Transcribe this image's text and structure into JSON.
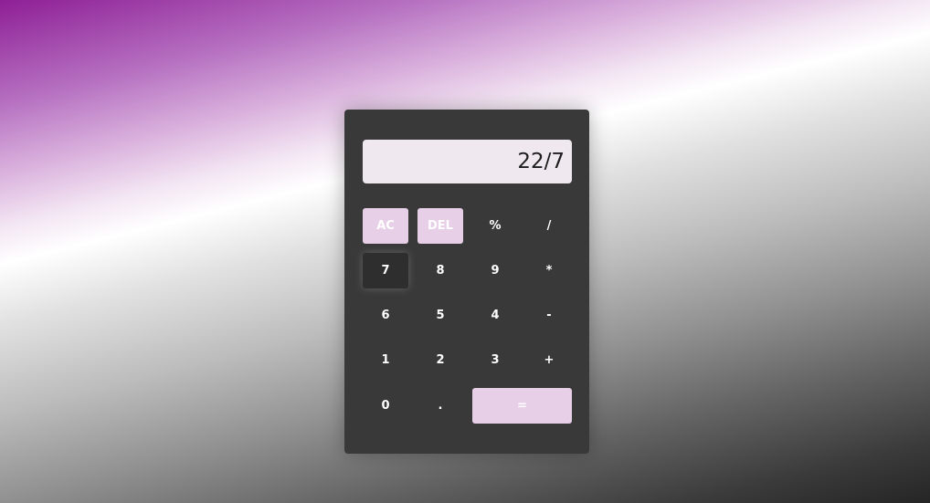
{
  "display": {
    "value": "22/7"
  },
  "keys": {
    "ac": "AC",
    "del": "DEL",
    "percent": "%",
    "divide": "/",
    "seven": "7",
    "eight": "8",
    "nine": "9",
    "multiply": "*",
    "six": "6",
    "five": "5",
    "four": "4",
    "minus": "-",
    "one": "1",
    "two": "2",
    "three": "3",
    "plus": "+",
    "zero": "0",
    "dot": ".",
    "equals": "="
  },
  "colors": {
    "calculator_body": "#393939",
    "display_bg": "#efe8ee",
    "accent_key": "#e8cfe8",
    "key_text": "#ffffff"
  }
}
